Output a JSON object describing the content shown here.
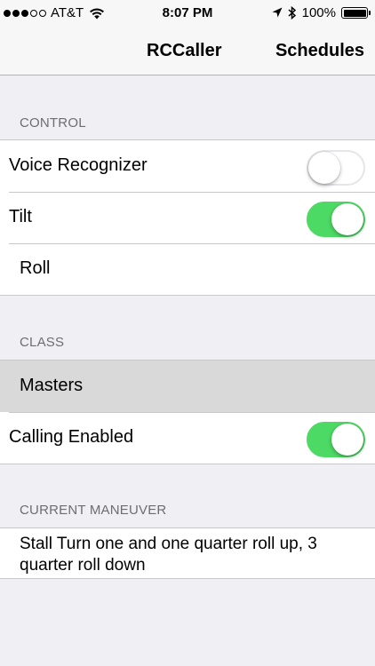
{
  "status_bar": {
    "carrier": "AT&T",
    "time": "8:07 PM",
    "battery": "100%",
    "signal_bars_filled": 3,
    "signal_bars_total": 5
  },
  "nav": {
    "title": "RCCaller",
    "right_button": "Schedules"
  },
  "sections": {
    "control": {
      "header": "CONTROL",
      "voice_recognizer": {
        "label": "Voice Recognizer",
        "enabled": false
      },
      "tilt": {
        "label": "Tilt",
        "enabled": true
      },
      "roll": {
        "label": "Roll"
      }
    },
    "class": {
      "header": "CLASS",
      "masters": {
        "label": "Masters"
      },
      "calling_enabled": {
        "label": "Calling Enabled",
        "enabled": true
      }
    },
    "current_maneuver": {
      "header": "CURRENT MANEUVER",
      "text": "Stall Turn one and one quarter roll up, 3 quarter roll down"
    }
  },
  "colors": {
    "toggle_on": "#4cd964",
    "background": "#efeff4",
    "selected_row": "#d9d9d9"
  },
  "icons": [
    "wifi-icon",
    "location-arrow-icon",
    "bluetooth-icon",
    "battery-icon"
  ]
}
